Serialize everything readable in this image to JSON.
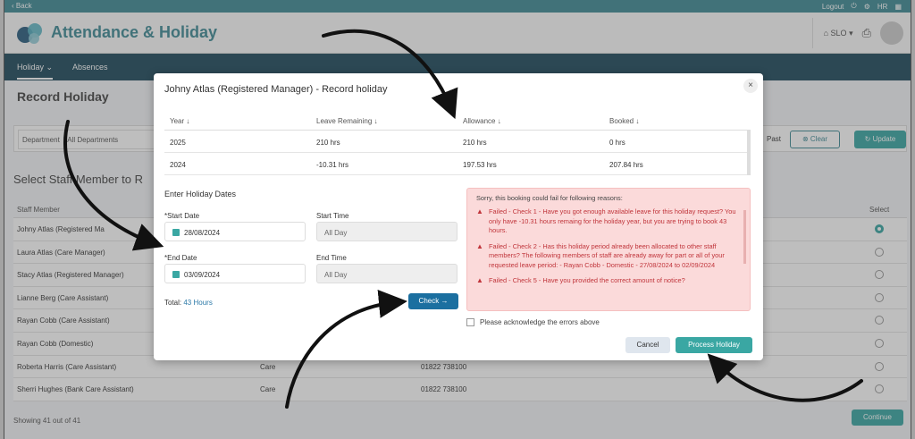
{
  "topbar": {
    "back": "‹ Back",
    "logout": "Logout",
    "hr": "HR"
  },
  "app": {
    "title": "Attendance & Holiday",
    "site": "SLO"
  },
  "nav": {
    "tabs": [
      "Holiday",
      "Absences"
    ]
  },
  "page": {
    "title": "Record Holiday"
  },
  "filters": {
    "department_label": "Department",
    "department_value": "All Departments",
    "past": "Past",
    "clear": "Clear",
    "update": "Update"
  },
  "staff": {
    "title": "Select Staff Member to R",
    "col_staff": "Staff Member",
    "col_select": "Select",
    "rows": [
      {
        "name": "Johny Atlas (Registered Ma",
        "dept": "",
        "phone": ""
      },
      {
        "name": "Laura Atlas (Care Manager)",
        "dept": "",
        "phone": ""
      },
      {
        "name": "Stacy Atlas (Registered Manager)",
        "dept": "",
        "phone": ""
      },
      {
        "name": "Lianne Berg (Care Assistant)",
        "dept": "",
        "phone": ""
      },
      {
        "name": "Rayan Cobb (Care Assistant)",
        "dept": "",
        "phone": ""
      },
      {
        "name": "Rayan Cobb (Domestic)",
        "dept": "",
        "phone": ""
      },
      {
        "name": "Roberta Harris (Care Assistant)",
        "dept": "Care",
        "phone": "01822 738100"
      },
      {
        "name": "Sherri Hughes (Bank Care Assistant)",
        "dept": "Care",
        "phone": "01822 738100"
      }
    ],
    "showing": "Showing 41 out of 41",
    "continue": "Continue"
  },
  "modal": {
    "title": "Johny Atlas (Registered Manager) - Record holiday",
    "close": "×",
    "summary_headers": [
      "Year ↓",
      "Leave Remaining ↓",
      "Allowance ↓",
      "Booked ↓"
    ],
    "summary_rows": [
      [
        "2025",
        "210 hrs",
        "210 hrs",
        "0 hrs"
      ],
      [
        "2024",
        "-10.31 hrs",
        "197.53 hrs",
        "207.84 hrs"
      ]
    ],
    "enter_dates": "Enter Holiday Dates",
    "start_date_label": "*Start Date",
    "start_date": "28/08/2024",
    "start_time_label": "Start Time",
    "start_time": "All Day",
    "end_date_label": "*End Date",
    "end_date": "03/09/2024",
    "end_time_label": "End Time",
    "end_time": "All Day",
    "total_label": "Total:",
    "total_value": "43 Hours",
    "check": "Check →",
    "errors_head": "Sorry, this booking could fail for following reasons:",
    "errors": [
      "Failed - Check 1 - Have you got enough available leave for this holiday request? You only have -10.31 hours remaing for the holiday year, but you are trying to book 43 hours.",
      "Failed - Check 2 - Has this holiday period already been allocated to other staff members? The following members of staff are already away for part or all of your requested leave period: - Rayan Cobb - Domestic - 27/08/2024 to 02/09/2024",
      "Failed - Check 5 - Have you provided the correct amount of notice?"
    ],
    "acknowledge": "Please acknowledge the errors above",
    "cancel": "Cancel",
    "process": "Process Holiday"
  }
}
